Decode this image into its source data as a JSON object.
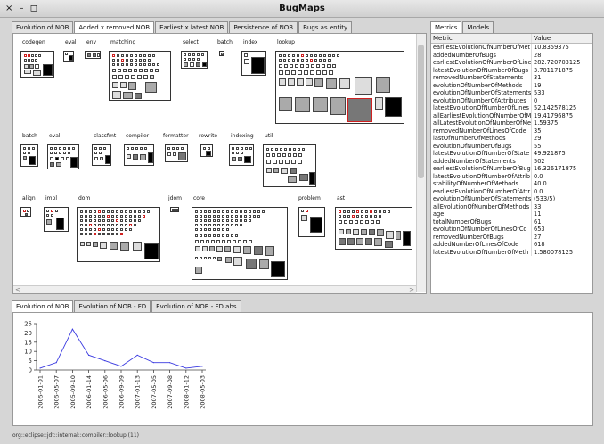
{
  "window": {
    "title": "BugMaps",
    "controls": "× – ◻"
  },
  "top_tabs": [
    {
      "label": "Evolution of NOB",
      "active": false
    },
    {
      "label": "Added x removed NOB",
      "active": true
    },
    {
      "label": "Earliest x latest NOB",
      "active": false
    },
    {
      "label": "Persistence of NOB",
      "active": false
    },
    {
      "label": "Bugs as entity",
      "active": false
    }
  ],
  "side_tabs": [
    {
      "label": "Metrics",
      "active": true
    },
    {
      "label": "Models",
      "active": false
    }
  ],
  "packages": [
    {
      "label": "codegen"
    },
    {
      "label": "eval"
    },
    {
      "label": "env"
    },
    {
      "label": "matching"
    },
    {
      "label": "select"
    },
    {
      "label": "batch"
    },
    {
      "label": "index"
    },
    {
      "label": "lookup"
    },
    {
      "label": "batch"
    },
    {
      "label": "eval"
    },
    {
      "label": "classfmt"
    },
    {
      "label": "compiler"
    },
    {
      "label": "formatter"
    },
    {
      "label": "rewrite"
    },
    {
      "label": "indexing"
    },
    {
      "label": "util"
    },
    {
      "label": "align"
    },
    {
      "label": "impl"
    },
    {
      "label": "dom"
    },
    {
      "label": "jdom"
    },
    {
      "label": "core"
    },
    {
      "label": "problem"
    },
    {
      "label": "ast"
    }
  ],
  "metrics": {
    "headers": {
      "metric": "Metric",
      "value": "Value"
    },
    "rows": [
      {
        "name": "earliestEvolutionOfNumberOfMet",
        "value": "10.8359375"
      },
      {
        "name": "addedNumberOfBugs",
        "value": "28"
      },
      {
        "name": "earliestEvolutionOfNumberOfLine",
        "value": "282.720703125"
      },
      {
        "name": "latestEvolutionOfNumberOfBugs",
        "value": "3.701171875"
      },
      {
        "name": "removedNumberOfStatements",
        "value": "31"
      },
      {
        "name": "evolutionOfNumberOfMethods",
        "value": "19"
      },
      {
        "name": "evolutionOfNumberOfStatements",
        "value": "533"
      },
      {
        "name": "evolutionOfNumberOfAttributes",
        "value": "0"
      },
      {
        "name": "latestEvolutionOfNumberOfLines",
        "value": "52.142578125"
      },
      {
        "name": "allEarliestEvolutionOfNumberOfM",
        "value": "19.41796875"
      },
      {
        "name": "allLatestEvolutionOfNumberOfMe",
        "value": "1.59375"
      },
      {
        "name": "removedNumberOfLinesOfCode",
        "value": "35"
      },
      {
        "name": "lastOfNumberOfMethods",
        "value": "29"
      },
      {
        "name": "evolutionOfNumberOfBugs",
        "value": "55"
      },
      {
        "name": "latestEvolutionOfNumberOfState",
        "value": "49.921875"
      },
      {
        "name": "addedNumberOfStatements",
        "value": "502"
      },
      {
        "name": "earliestEvolutionOfNumberOfBug",
        "value": "16.326171875"
      },
      {
        "name": "latestEvolutionOfNumberOfAttrib",
        "value": "0.0"
      },
      {
        "name": "stabilityOfNumberOfMethods",
        "value": "40.0"
      },
      {
        "name": "earliestEvolutionOfNumberOfAttr",
        "value": "0.0"
      },
      {
        "name": "evolutionOfNumberOfStatements",
        "value": "(533/5)"
      },
      {
        "name": "allEvolutionOfNumberOfMethods",
        "value": "33"
      },
      {
        "name": "age",
        "value": "11"
      },
      {
        "name": "totalNumberOfBugs",
        "value": "61"
      },
      {
        "name": "evolutionOfNumberOfLinesOfCo",
        "value": "653"
      },
      {
        "name": "removedNumberOfBugs",
        "value": "27"
      },
      {
        "name": "addedNumberOfLinesOfCode",
        "value": "618"
      },
      {
        "name": "latestEvolutionOfNumberOfMeth",
        "value": "1.580078125"
      }
    ]
  },
  "bottom_tabs": [
    {
      "label": "Evolution of NOB",
      "active": true
    },
    {
      "label": "Evolution of NOB - FD",
      "active": false
    },
    {
      "label": "Evolution of NOB - FD abs",
      "active": false
    }
  ],
  "chart_data": {
    "type": "line",
    "x": [
      "2005-01-01",
      "2005-05-07",
      "2005-09-10",
      "2006-01-14",
      "2006-05-06",
      "2006-09-09",
      "2007-01-13",
      "2007-05-05",
      "2007-09-08",
      "2008-01-12",
      "2008-05-03"
    ],
    "values": [
      1,
      4,
      22,
      8,
      5,
      2,
      8,
      4,
      4,
      1,
      2
    ],
    "yticks": [
      0,
      5,
      10,
      15,
      20,
      25
    ],
    "ylim": [
      0,
      25
    ],
    "color": "#3a3ae0",
    "title": "",
    "xlabel": "",
    "ylabel": ""
  },
  "status": {
    "text": "org::eclipse::jdt::internal::compiler::lookup (11)"
  },
  "scroll": {
    "left_arrow": "<",
    "right_arrow": ">"
  }
}
